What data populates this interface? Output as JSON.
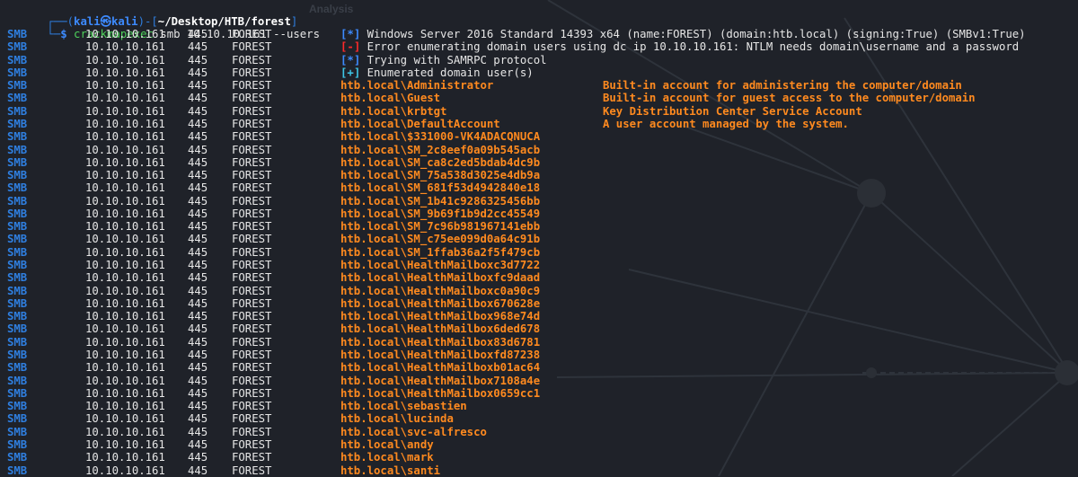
{
  "background_labels": {
    "analysis": "Analysis"
  },
  "prompt": {
    "frame_top": "┌──(",
    "user": "kali㉿kali",
    "mid": ")-[",
    "path": "~/Desktop/HTB/forest",
    "end": "]",
    "frame_bottom": "└─",
    "dollar": "$ ",
    "command": "crackmapexec",
    "args": " smb 10.10.10.161 --users"
  },
  "row_fields": {
    "proto": "SMB",
    "ip": "10.10.10.161",
    "port": "445",
    "host": "FOREST"
  },
  "status_lines": [
    {
      "bracket_left": "[",
      "symbol": "*",
      "bracket_right": "]",
      "text": " Windows Server 2016 Standard 14393 x64 (name:FOREST) (domain:htb.local) (signing:True) (SMBv1:True)"
    },
    {
      "bracket_left": "[",
      "symbol": "-",
      "bracket_right": "]",
      "text": " Error enumerating domain users using dc ip 10.10.10.161: NTLM needs domain\\username and a password"
    },
    {
      "bracket_left": "[",
      "symbol": "*",
      "bracket_right": "]",
      "text": " Trying with SAMRPC protocol"
    },
    {
      "bracket_left": "[",
      "symbol": "+",
      "bracket_right": "]",
      "text": " Enumerated domain user(s)"
    }
  ],
  "users": [
    {
      "name": "htb.local\\Administrator",
      "desc": "Built-in account for administering the computer/domain"
    },
    {
      "name": "htb.local\\Guest",
      "desc": "Built-in account for guest access to the computer/domain"
    },
    {
      "name": "htb.local\\krbtgt",
      "desc": "Key Distribution Center Service Account"
    },
    {
      "name": "htb.local\\DefaultAccount",
      "desc": "A user account managed by the system."
    },
    {
      "name": "htb.local\\$331000-VK4ADACQNUCA",
      "desc": ""
    },
    {
      "name": "htb.local\\SM_2c8eef0a09b545acb",
      "desc": ""
    },
    {
      "name": "htb.local\\SM_ca8c2ed5bdab4dc9b",
      "desc": ""
    },
    {
      "name": "htb.local\\SM_75a538d3025e4db9a",
      "desc": ""
    },
    {
      "name": "htb.local\\SM_681f53d4942840e18",
      "desc": ""
    },
    {
      "name": "htb.local\\SM_1b41c9286325456bb",
      "desc": ""
    },
    {
      "name": "htb.local\\SM_9b69f1b9d2cc45549",
      "desc": ""
    },
    {
      "name": "htb.local\\SM_7c96b981967141ebb",
      "desc": ""
    },
    {
      "name": "htb.local\\SM_c75ee099d0a64c91b",
      "desc": ""
    },
    {
      "name": "htb.local\\SM_1ffab36a2f5f479cb",
      "desc": ""
    },
    {
      "name": "htb.local\\HealthMailboxc3d7722",
      "desc": ""
    },
    {
      "name": "htb.local\\HealthMailboxfc9daad",
      "desc": ""
    },
    {
      "name": "htb.local\\HealthMailboxc0a90c9",
      "desc": ""
    },
    {
      "name": "htb.local\\HealthMailbox670628e",
      "desc": ""
    },
    {
      "name": "htb.local\\HealthMailbox968e74d",
      "desc": ""
    },
    {
      "name": "htb.local\\HealthMailbox6ded678",
      "desc": ""
    },
    {
      "name": "htb.local\\HealthMailbox83d6781",
      "desc": ""
    },
    {
      "name": "htb.local\\HealthMailboxfd87238",
      "desc": ""
    },
    {
      "name": "htb.local\\HealthMailboxb01ac64",
      "desc": ""
    },
    {
      "name": "htb.local\\HealthMailbox7108a4e",
      "desc": ""
    },
    {
      "name": "htb.local\\HealthMailbox0659cc1",
      "desc": ""
    },
    {
      "name": "htb.local\\sebastien",
      "desc": ""
    },
    {
      "name": "htb.local\\lucinda",
      "desc": ""
    },
    {
      "name": "htb.local\\svc-alfresco",
      "desc": ""
    },
    {
      "name": "htb.local\\andy",
      "desc": ""
    },
    {
      "name": "htb.local\\mark",
      "desc": ""
    },
    {
      "name": "htb.local\\santi",
      "desc": ""
    }
  ],
  "colors": {
    "background": "#1f2229",
    "proto": "#2f7fe0",
    "user": "#ff8a1f",
    "info": "#3d8bff",
    "error": "#ff2a2a",
    "success": "#3ec6e6",
    "command": "#4fd35c"
  }
}
